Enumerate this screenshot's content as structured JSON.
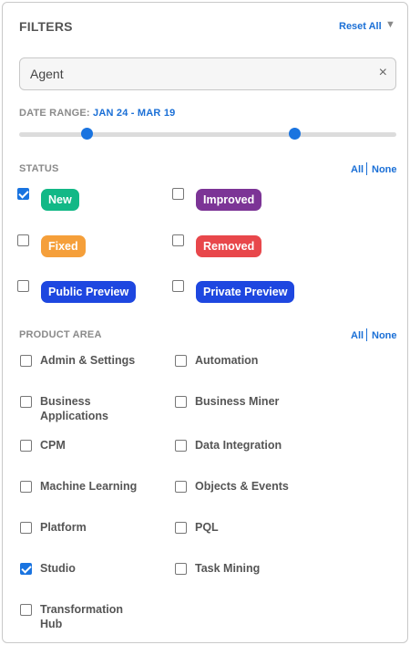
{
  "header": {
    "title": "FILTERS",
    "reset_label": "Reset All",
    "caret": "▼"
  },
  "search": {
    "value": "Agent",
    "clear": "×"
  },
  "date_range": {
    "label": "DATE RANGE:",
    "value": "JAN 24 - MAR 19",
    "range_fraction": [
      0.18,
      0.73
    ]
  },
  "status": {
    "title": "STATUS",
    "all_label": "All",
    "none_label": "None",
    "items": [
      {
        "label": "New",
        "checked": true,
        "color": "#12b886"
      },
      {
        "label": "Improved",
        "checked": false,
        "color": "#7c3496"
      },
      {
        "label": "Fixed",
        "checked": false,
        "color": "#f59f3a"
      },
      {
        "label": "Removed",
        "checked": false,
        "color": "#e8474b"
      },
      {
        "label": "Public Preview",
        "checked": false,
        "color": "#1e47e0"
      },
      {
        "label": "Private Preview",
        "checked": false,
        "color": "#1e47e0"
      }
    ]
  },
  "product_area": {
    "title": "PRODUCT AREA",
    "all_label": "All",
    "none_label": "None",
    "items": [
      {
        "label": "Admin & Settings",
        "checked": false
      },
      {
        "label": "Automation",
        "checked": false
      },
      {
        "label": "Business Applications",
        "checked": false
      },
      {
        "label": "Business Miner",
        "checked": false
      },
      {
        "label": "CPM",
        "checked": false
      },
      {
        "label": "Data Integration",
        "checked": false
      },
      {
        "label": "Machine Learning",
        "checked": false
      },
      {
        "label": "Objects & Events",
        "checked": false
      },
      {
        "label": "Platform",
        "checked": false
      },
      {
        "label": "PQL",
        "checked": false
      },
      {
        "label": "Studio",
        "checked": true
      },
      {
        "label": "Task Mining",
        "checked": false
      },
      {
        "label": "Transformation Hub",
        "checked": false
      }
    ]
  }
}
